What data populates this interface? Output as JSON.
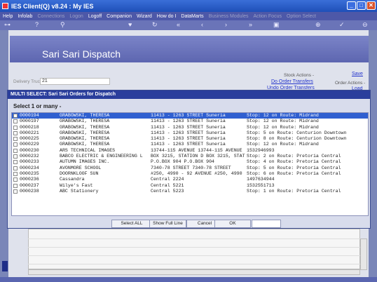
{
  "window": {
    "title": "IES Client(Q) v8.24 : My IES",
    "controls": [
      "_",
      "□",
      "✕"
    ]
  },
  "menu": {
    "items": [
      {
        "label": "Help",
        "enabled": true
      },
      {
        "label": "Infolab",
        "enabled": true
      },
      {
        "label": "Connections",
        "enabled": false
      },
      {
        "label": "Logon",
        "enabled": false
      },
      {
        "label": "Logoff",
        "enabled": true
      },
      {
        "label": "Companion",
        "enabled": true
      },
      {
        "label": "Wizard",
        "enabled": true
      },
      {
        "label": "How do I",
        "enabled": true
      },
      {
        "label": "DataMarts",
        "enabled": true
      },
      {
        "label": "Business Modules",
        "enabled": false
      },
      {
        "label": "Action Focus",
        "enabled": false
      },
      {
        "label": "Option Select",
        "enabled": false
      }
    ]
  },
  "toolbar": {
    "icons": [
      "key-icon",
      "help-icon",
      "search-icon",
      "heart-icon",
      "refresh-icon",
      "rewind-icon",
      "back-icon",
      "forward-icon",
      "fast-forward-icon",
      "save-icon",
      "add-icon",
      "check-icon",
      "minus-icon"
    ]
  },
  "screen": {
    "title": "Sari Sari Dispatch",
    "delivery_truck_label": "Delivery Truck",
    "delivery_truck_value": "21",
    "stock_actions_label": "Stock Actions -",
    "do_order_transfers": "Do Order Transfers",
    "undo_order_transfers": "Undo Order Transfers",
    "save_link": "Save",
    "order_actions_label": "Order Actions -",
    "load_link": "Load"
  },
  "dialog": {
    "title": "MULTI SELECT: Sari Sari Orders for Dispatch",
    "prompt": "Select 1 or many -",
    "rows": [
      {
        "id": "0000194",
        "customer": "GRABOWSKI, THERESA",
        "address": "11413 - 1263 STREET Suneria",
        "route": "Stop: 12 on Route: Midrand",
        "selected": true
      },
      {
        "id": "0000197",
        "customer": "GRABOWSKI, THERESA",
        "address": "11413 - 1263 STREET Suneria",
        "route": "Stop: 12 on Route: Midrand",
        "selected": false
      },
      {
        "id": "0000218",
        "customer": "GRABOWSKI, THERESA",
        "address": "11413 - 1263 STREET Suneria",
        "route": "Stop: 12 on Route: Midrand",
        "selected": false
      },
      {
        "id": "0000221",
        "customer": "GRABOWSKI, THERESA",
        "address": "11413 - 1263 STREET Suneria",
        "route": "Stop: 5 on Route: Centurion Downtown",
        "selected": false
      },
      {
        "id": "0000225",
        "customer": "GRABOWSKI, THERESA",
        "address": "11413 - 1263 STREET Suneria",
        "route": "Stop: 8 on Route: Centurion Downtown",
        "selected": false
      },
      {
        "id": "0000229",
        "customer": "GRABOWSKI, THERESA",
        "address": "11413 - 1263 STREET Suneria",
        "route": "Stop: 12 on Route: Midrand",
        "selected": false
      },
      {
        "id": "0000230",
        "customer": "ARS TECHNICAL IMAGES",
        "address": "13744-115 AVENUE 13744-115 AVENUE",
        "route": "1532946993",
        "selected": false
      },
      {
        "id": "0000232",
        "customer": "BABCO ELECTRIC & ENGINEERING L",
        "address": "BOX 3215, STATION D BOX 3215, STATION D",
        "route": "Stop: 2 on Route: Pretoria Central",
        "selected": false
      },
      {
        "id": "0000233",
        "customer": "AUTUMN IMAGES INC.",
        "address": "P.O.BOX 904 P.O.BOX 904",
        "route": "Stop: 4 on Route: Pretoria Central",
        "selected": false
      },
      {
        "id": "0000234",
        "customer": "AVONMORE SCHOOL",
        "address": "7340-78 STREET 7340-78 STREET",
        "route": "Stop: 5 on Route: Pretoria Central",
        "selected": false
      },
      {
        "id": "0000235",
        "customer": "DOORNKLOOF SUN",
        "address": "#250, 4990 - 92 AVENUE #250, 4990 - 92 A",
        "route": "Stop: 6 on Route: Pretoria Central",
        "selected": false
      },
      {
        "id": "0000236",
        "customer": "Cassandra",
        "address": "Central 2224",
        "route": "1497634944",
        "selected": false
      },
      {
        "id": "0000237",
        "customer": "Wilye's Fast",
        "address": "Central 5221",
        "route": "1532551713",
        "selected": false
      },
      {
        "id": "0000238",
        "customer": "ABC Stationery",
        "address": "Central 5223",
        "route": "Stop: 1 on Route: Pretoria Central",
        "selected": false
      }
    ],
    "buttons": {
      "select_all": "Select ALL",
      "show_full_line": "Show Full Line",
      "cancel": "Cancel",
      "ok": "OK"
    }
  }
}
